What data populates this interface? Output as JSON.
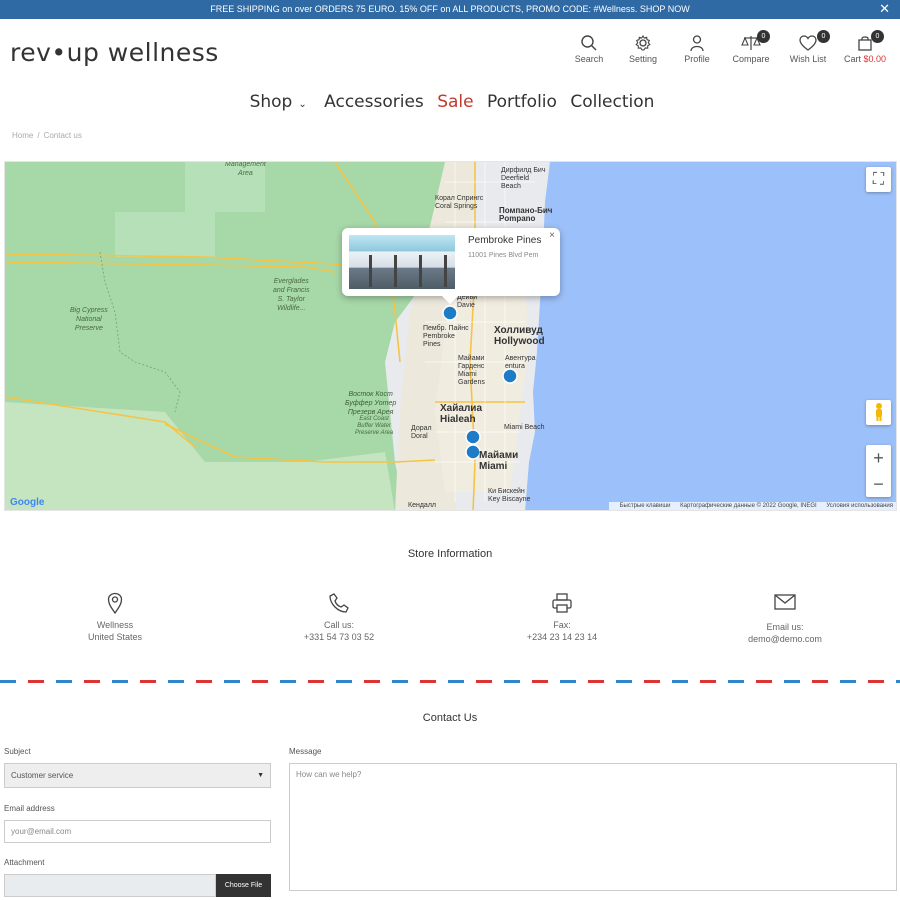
{
  "promo": {
    "text": "FREE SHIPPING on over ORDERS 75 EURO. 15% OFF on ALL PRODUCTS, PROMO CODE: #Wellness. SHOP NOW",
    "close": "✕",
    "bg": "#2f6aa5"
  },
  "logo": "rev•up wellness",
  "header_icons": [
    {
      "label": "Search",
      "icon": "search-icon"
    },
    {
      "label": "Setting",
      "icon": "gear-icon"
    },
    {
      "label": "Profile",
      "icon": "user-icon"
    },
    {
      "label": "Compare",
      "icon": "scale-icon",
      "count": "0"
    },
    {
      "label": "Wish List",
      "icon": "heart-icon",
      "count": "0"
    },
    {
      "label": "Cart",
      "icon": "bag-icon",
      "count": "0",
      "price": "$0.00"
    }
  ],
  "nav": {
    "shop": "Shop",
    "accessories": "Accessories",
    "sale": "Sale",
    "portfolio": "Portfolio",
    "collection": "Collection",
    "sale_color": "#c0392b"
  },
  "breadcrumb": {
    "home": "Home",
    "sep": "/",
    "current": "Contact us"
  },
  "map": {
    "popup_title": "Pembroke Pines",
    "popup_address": "11001 Pines Blvd Pem",
    "popup_close": "×",
    "labels": {
      "management": "Management\nArea",
      "everglades": "Everglades\nand Francis\nS. Taylor\nWildlife...",
      "big_cypress": "Big Cypress\nNational\nPreserve",
      "east_coast": "Восток Кост\nБуффер Уотер\nПрезерв Арея",
      "east_coast_en": "East Coast\nBuffer Water\nPreserve Area"
    },
    "cities": {
      "deerfield": "Дирфилд Бич\nDeerfield\nBeach",
      "coral_springs": "Корал Спрингс\nCoral Springs",
      "pompano": "Помпано-Бич\nPompano",
      "davie": "Дейви\nDavie",
      "pembroke": "Пембр. Пайнс\nPembroke\nPines",
      "hollywood": "Холливуд\nHollywood",
      "aventura": "Авентура\nentura",
      "miami_gardens": "Майами\nГарденс\nMiami\nGardens",
      "hialeah": "Хайалиа\nHialeah",
      "doral": "Дорал\nDoral",
      "miami_beach": "Miami Beach",
      "miami": "Майами\nMiami",
      "key_biscayne": "Ки Бискейн\nKey Biscayne",
      "kendall": "Кендалл"
    },
    "roads": [
      "75",
      "93",
      "75",
      "93",
      "75",
      "41",
      "41",
      "41",
      "826",
      "836",
      "A1A"
    ],
    "google": "Google",
    "attribution": [
      "Быстрые клавиши",
      "Картографические данные © 2022 Google, INEGI",
      "Условия использования"
    ],
    "zoom_in": "+",
    "zoom_out": "−",
    "fullscreen": "⛶"
  },
  "store": {
    "title": "Store Information",
    "items": [
      {
        "icon": "location-pin-icon",
        "line1": "Wellness",
        "line2": "United States"
      },
      {
        "icon": "phone-icon",
        "line1": "Call us:",
        "line2": "+331 54 73 03 52"
      },
      {
        "icon": "printer-icon",
        "line1": "Fax:",
        "line2": "+234 23 14 23 14"
      },
      {
        "icon": "mail-icon",
        "line1": "Email us:",
        "line2": "demo@demo.com"
      }
    ]
  },
  "contact": {
    "title": "Contact Us",
    "subject_label": "Subject",
    "subject_value": "Customer service",
    "email_label": "Email address",
    "email_placeholder": "your@email.com",
    "attachment_label": "Attachment",
    "choose_file": "Choose File",
    "message_label": "Message",
    "message_placeholder": "How can we help?"
  }
}
